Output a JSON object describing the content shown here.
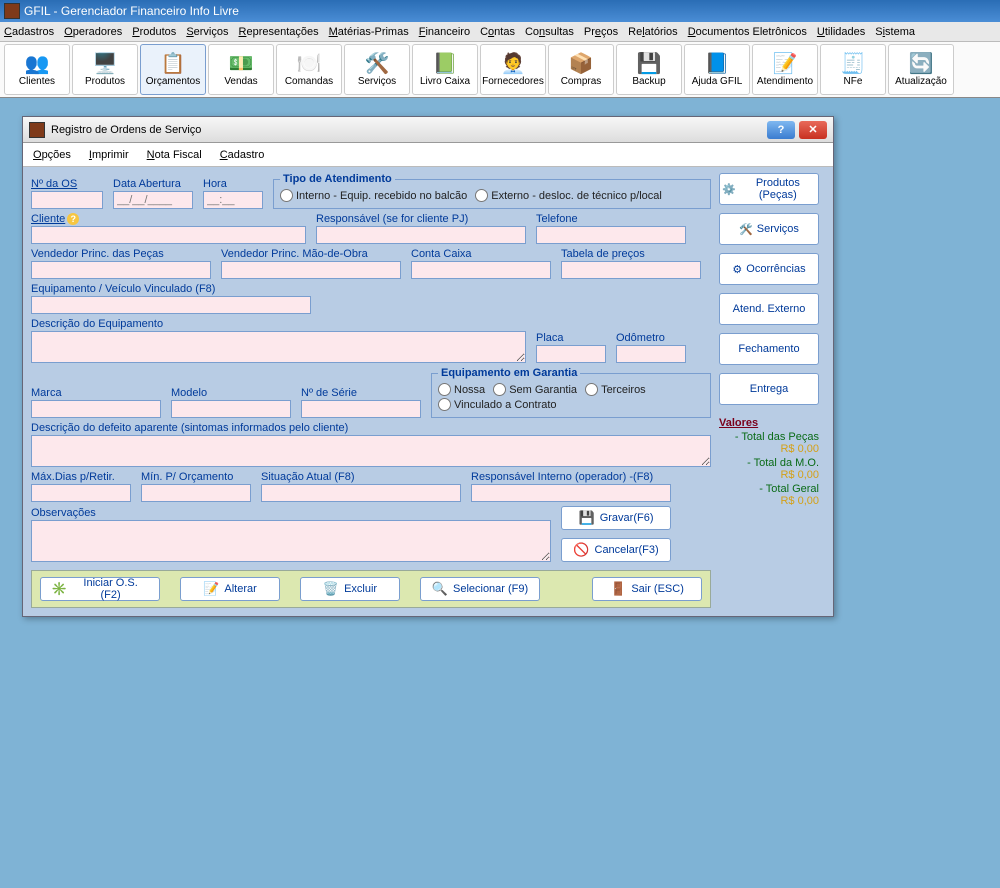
{
  "app": {
    "title": "GFIL - Gerenciador Financeiro Info Livre"
  },
  "menubar": [
    "Cadastros",
    "Operadores",
    "Produtos",
    "Serviços",
    "Representações",
    "Matérias-Primas",
    "Financeiro",
    "Contas",
    "Consultas",
    "Preços",
    "Relatórios",
    "Documentos Eletrônicos",
    "Utilidades",
    "Sistema"
  ],
  "toolbar": [
    {
      "label": "Clientes",
      "icon": "👥"
    },
    {
      "label": "Produtos",
      "icon": "🖥️"
    },
    {
      "label": "Orçamentos",
      "icon": "📋"
    },
    {
      "label": "Vendas",
      "icon": "💵"
    },
    {
      "label": "Comandas",
      "icon": "🍽️"
    },
    {
      "label": "Serviços",
      "icon": "🛠️"
    },
    {
      "label": "Livro Caixa",
      "icon": "📗"
    },
    {
      "label": "Fornecedores",
      "icon": "🧑‍💼"
    },
    {
      "label": "Compras",
      "icon": "📦"
    },
    {
      "label": "Backup",
      "icon": "💾"
    },
    {
      "label": "Ajuda GFIL",
      "icon": "📘"
    },
    {
      "label": "Atendimento",
      "icon": "📝"
    },
    {
      "label": "NFe",
      "icon": "🧾"
    },
    {
      "label": "Atualização",
      "icon": "🔄"
    }
  ],
  "dialog": {
    "title": "Registro de Ordens de Serviço",
    "menu": [
      "Opções",
      "Imprimir",
      "Nota Fiscal",
      "Cadastro"
    ],
    "labels": {
      "os_num": "Nº da OS",
      "data_abertura": "Data Abertura",
      "data_placeholder": "__/__/____",
      "hora": "Hora",
      "hora_placeholder": "__:__",
      "tipo_atend_legend": "Tipo de Atendimento",
      "tipo_interno": "Interno - Equip. recebido no balcão",
      "tipo_externo": "Externo - desloc. de técnico p/local",
      "cliente": "Cliente",
      "responsavel_pj": "Responsável (se for cliente PJ)",
      "telefone": "Telefone",
      "vend_pecas": "Vendedor Princ. das Peças",
      "vend_mo": "Vendedor Princ. Mão-de-Obra",
      "conta_caixa": "Conta Caixa",
      "tabela_precos": "Tabela de preços",
      "equip_vinc": "Equipamento / Veículo Vinculado (F8)",
      "desc_equip": "Descrição do Equipamento",
      "placa": "Placa",
      "odometro": "Odômetro",
      "marca": "Marca",
      "modelo": "Modelo",
      "n_serie": "Nº de Série",
      "garantia_legend": "Equipamento em Garantia",
      "gar_nossa": "Nossa",
      "gar_sem": "Sem Garantia",
      "gar_terc": "Terceiros",
      "gar_vinc": "Vinculado a Contrato",
      "desc_defeito": "Descrição do defeito aparente (sintomas informados pelo cliente)",
      "max_dias": "Máx.Dias p/Retir.",
      "min_orc": "Mín. P/ Orçamento",
      "sit_atual": "Situação Atual (F8)",
      "resp_interno": "Responsável Interno (operador) -(F8)",
      "observacoes": "Observações"
    },
    "side_buttons": {
      "produtos": "Produtos (Peças)",
      "servicos": "Serviços",
      "ocorrencias": "Ocorrências",
      "atend_ext": "Atend. Externo",
      "fechamento": "Fechamento",
      "entrega": "Entrega"
    },
    "valores": {
      "header": "Valores",
      "pecas_lbl": "- Total das Peças",
      "pecas_val": "R$ 0,00",
      "mo_lbl": "- Total da M.O.",
      "mo_val": "R$ 0,00",
      "geral_lbl": "- Total Geral",
      "geral_val": "R$ 0,00"
    },
    "buttons": {
      "gravar": "Gravar(F6)",
      "cancelar": "Cancelar(F3)",
      "iniciar": "Iniciar O.S. (F2)",
      "alterar": "Alterar",
      "excluir": "Excluir",
      "selecionar": "Selecionar (F9)",
      "sair": "Sair (ESC)"
    }
  }
}
